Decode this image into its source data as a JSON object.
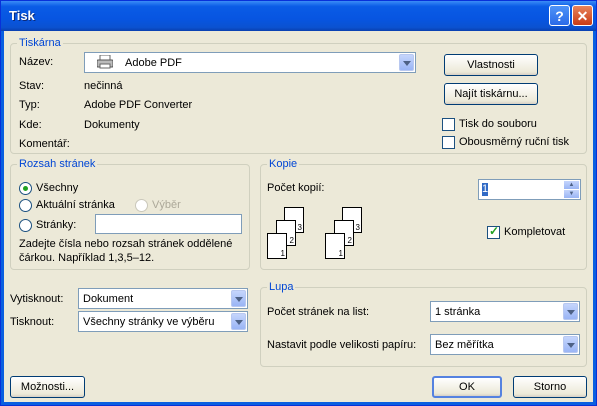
{
  "window": {
    "title": "Tisk"
  },
  "printer": {
    "legend": "Tiskárna",
    "name_label": "Název:",
    "name_value": "Adobe PDF",
    "status_label": "Stav:",
    "status_value": "nečinná",
    "type_label": "Typ:",
    "type_value": "Adobe PDF Converter",
    "where_label": "Kde:",
    "where_value": "Dokumenty",
    "comment_label": "Komentář:",
    "properties_button": "Vlastnosti",
    "find_button": "Najít tiskárnu...",
    "print_to_file": {
      "label": "Tisk do souboru",
      "checked": false
    },
    "manual_duplex": {
      "label": "Obousměrný ruční tisk",
      "checked": false
    }
  },
  "page_range": {
    "legend": "Rozsah stránek",
    "all": "Všechny",
    "current": "Aktuální stránka",
    "selection": "Výběr",
    "pages": "Stránky:",
    "pages_value": "",
    "hint": "Zadejte čísla nebo rozsah stránek oddělené čárkou. Například 1,3,5–12.",
    "selected": "all"
  },
  "copies": {
    "legend": "Kopie",
    "count_label": "Počet kopií:",
    "count_value": "1",
    "collate": {
      "label": "Kompletovat",
      "checked": true
    },
    "sheet_numbers": [
      "3",
      "2",
      "1"
    ]
  },
  "print_what": {
    "label": "Vytisknout:",
    "value": "Dokument"
  },
  "print": {
    "label": "Tisknout:",
    "value": "Všechny stránky ve výběru"
  },
  "zoom": {
    "legend": "Lupa",
    "pages_per_sheet_label": "Počet stránek na list:",
    "pages_per_sheet_value": "1 stránka",
    "scale_label": "Nastavit podle velikosti papíru:",
    "scale_value": "Bez měřítka"
  },
  "footer": {
    "options_button": "Možnosti...",
    "ok_button": "OK",
    "cancel_button": "Storno"
  }
}
